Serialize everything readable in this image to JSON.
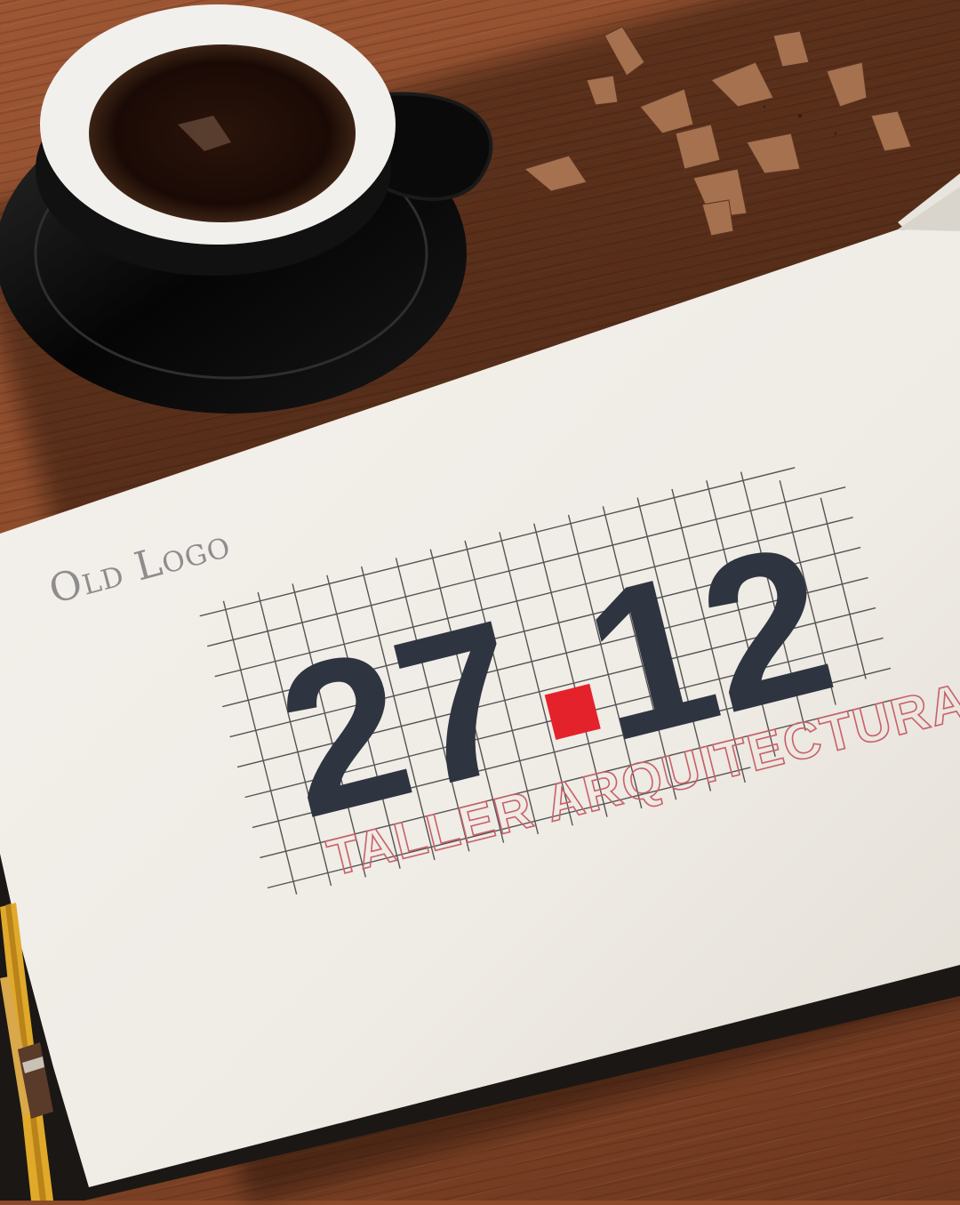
{
  "page": {
    "label": "Old Logo"
  },
  "logo": {
    "numerals_left": "27",
    "numerals_right": "12",
    "tagline": "TALLER ARQUITECTURA.",
    "colors": {
      "numerals": "#2e3440",
      "accent_square": "#e3222b",
      "tagline_outline": "#c8616a",
      "grid": "#3a3a3a"
    }
  },
  "props": {
    "items": [
      "coffee-cup",
      "saucer",
      "pencil-shavings",
      "sketchbook",
      "pencil-yellow",
      "pencil-brown"
    ]
  }
}
